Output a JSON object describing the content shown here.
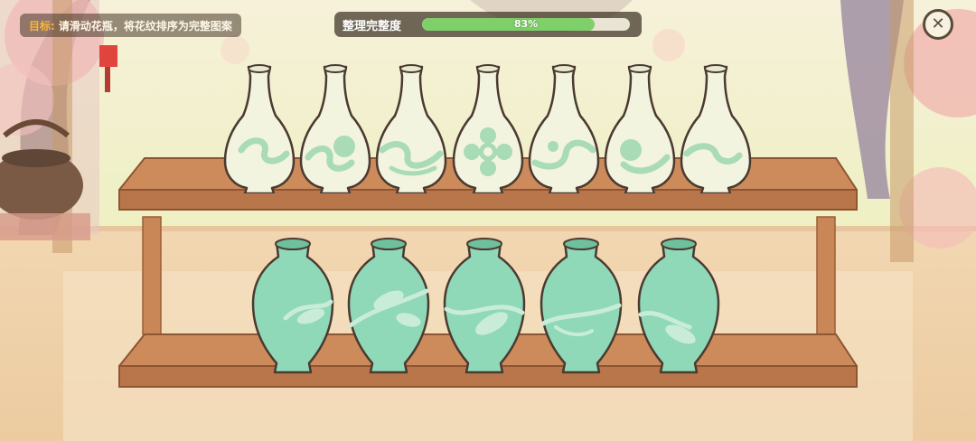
{
  "goal": {
    "label": "目标:",
    "text": "请滑动花瓶，将花纹排序为完整图案"
  },
  "progress": {
    "title": "整理完整度",
    "percent": 83,
    "percent_text": "83%"
  },
  "close_icon": "close-icon",
  "colors": {
    "progress_fill": "#7fcf6a",
    "goal_label": "#f5b63a",
    "shelf_wood": "#c98656",
    "vase_white": "#f2f3df",
    "vase_celadon": "#8fd8b8"
  },
  "shelves": {
    "top": {
      "vases": [
        {
          "name": "vase-top-1",
          "pattern": "swirl-left"
        },
        {
          "name": "vase-top-2",
          "pattern": "flower-swirl"
        },
        {
          "name": "vase-top-3",
          "pattern": "swirl-wave"
        },
        {
          "name": "vase-top-4",
          "pattern": "flower-center"
        },
        {
          "name": "vase-top-5",
          "pattern": "swirl-curl"
        },
        {
          "name": "vase-top-6",
          "pattern": "flower-swirl-right"
        },
        {
          "name": "vase-top-7",
          "pattern": "swirl-right"
        }
      ]
    },
    "bottom": {
      "vases": [
        {
          "name": "vase-bottom-1",
          "pattern": "leaf-left"
        },
        {
          "name": "vase-bottom-2",
          "pattern": "leaf-branch"
        },
        {
          "name": "vase-bottom-3",
          "pattern": "leaf-wave"
        },
        {
          "name": "vase-bottom-4",
          "pattern": "leaf-stem"
        },
        {
          "name": "vase-bottom-5",
          "pattern": "leaf-right"
        }
      ]
    }
  }
}
